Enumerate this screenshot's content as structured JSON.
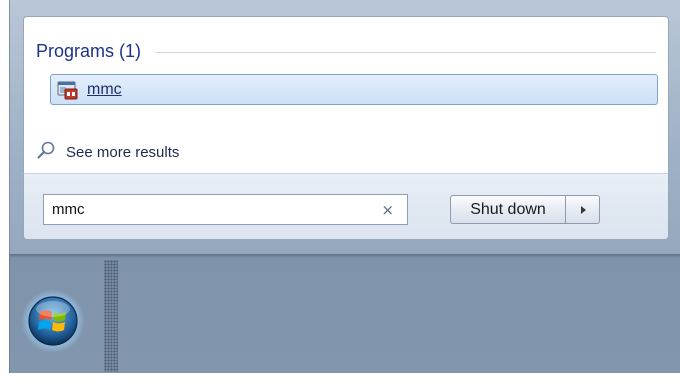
{
  "search_results": {
    "section_heading": "Programs (1)",
    "items": [
      {
        "label": "mmc",
        "icon": "mmc-console-icon"
      }
    ],
    "see_more_label": "See more results"
  },
  "search": {
    "value": "mmc",
    "clear_glyph": "×"
  },
  "power": {
    "shutdown_label": "Shut down",
    "options_glyph": "▸"
  },
  "taskbar": {
    "start_button_icon": "windows-orb-icon"
  }
}
